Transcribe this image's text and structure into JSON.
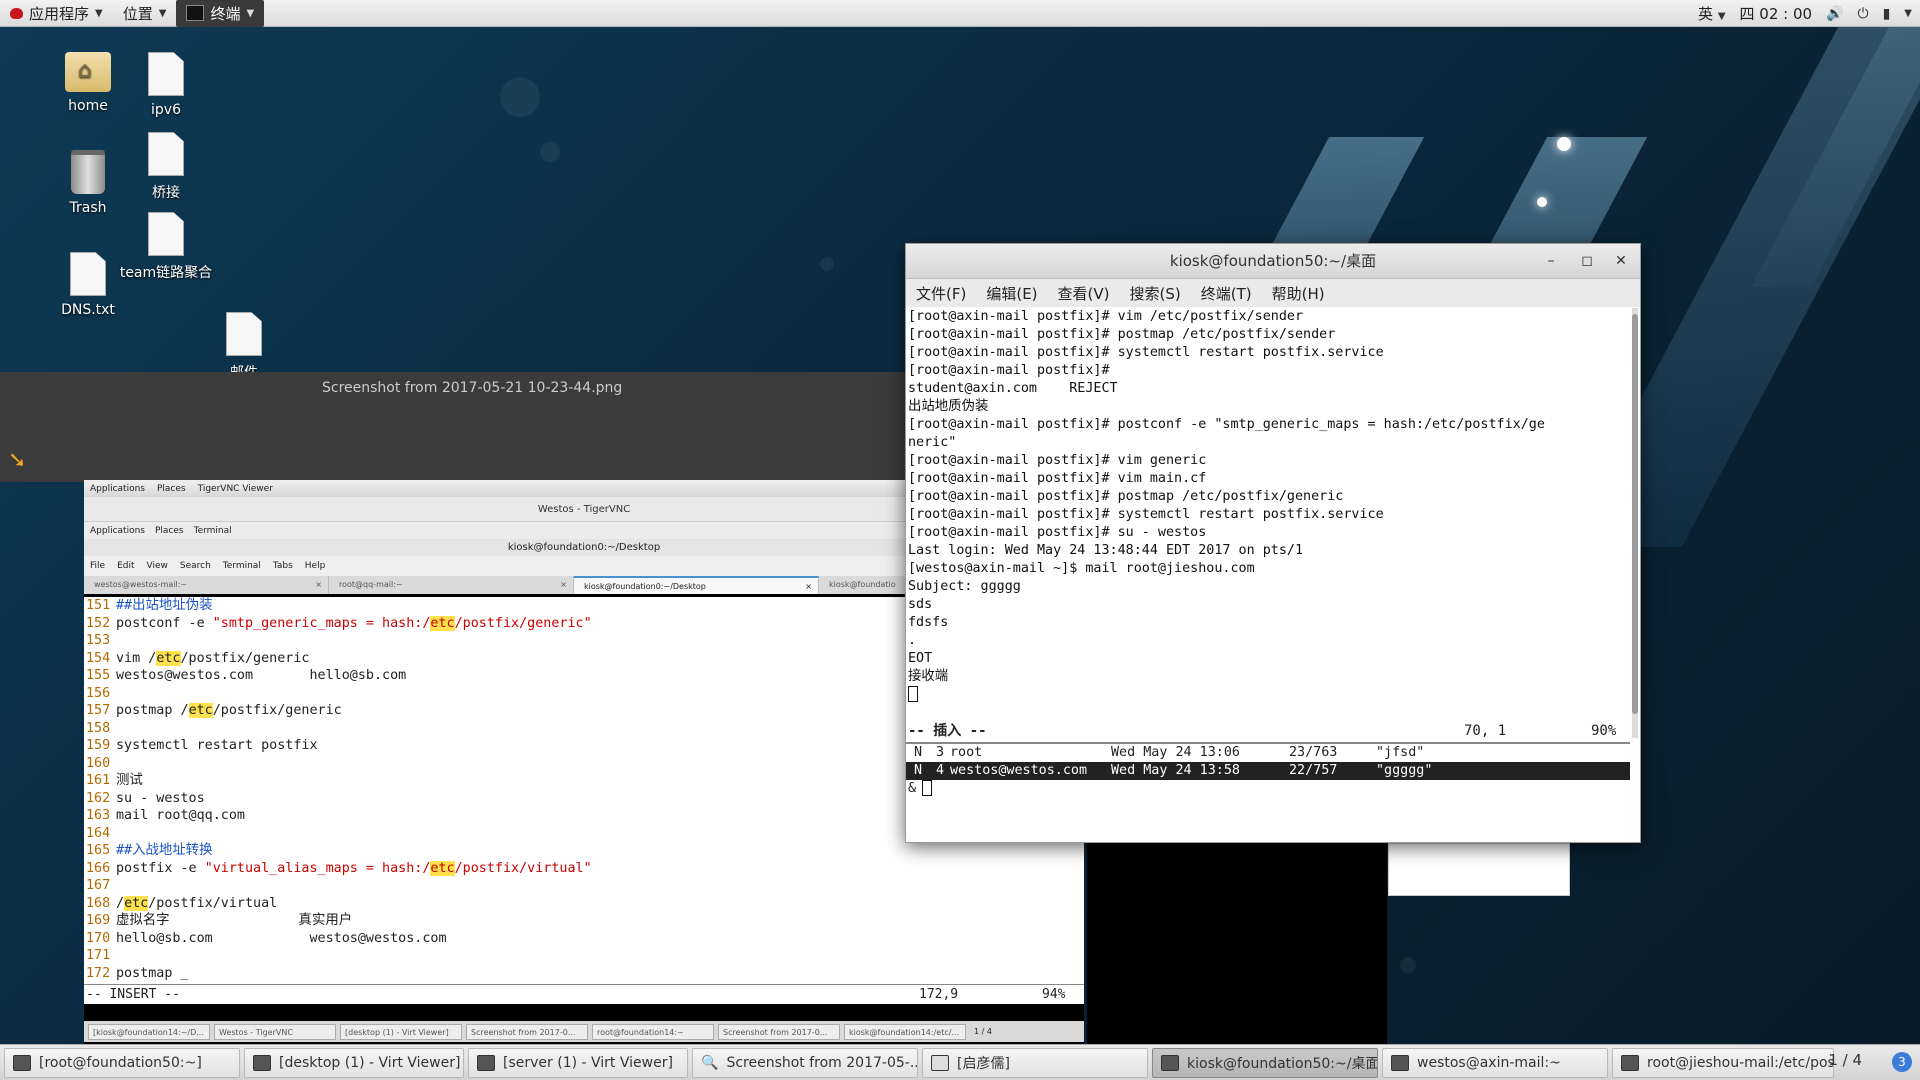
{
  "top_panel": {
    "applications": "应用程序",
    "places": "位置",
    "terminal": "终端",
    "input_method": "英",
    "clock": "四 02 : 00"
  },
  "desktop": {
    "icons": [
      "home",
      "ipv6",
      "Trash",
      "桥接",
      "team链路聚合",
      "DNS.txt",
      "邮件"
    ]
  },
  "viewer": {
    "title": "Screenshot from 2017-05-21 10-23-44.png"
  },
  "vnc": {
    "panel_apps": "Applications",
    "panel_places": "Places",
    "panel_viewer": "TigerVNC Viewer",
    "window_title": "Westos - TigerVNC",
    "inner_apps": "Applications",
    "inner_places": "Places",
    "inner_terminal": "Terminal",
    "term_title": "kiosk@foundation0:~/Desktop",
    "menu": [
      "File",
      "Edit",
      "View",
      "Search",
      "Terminal",
      "Tabs",
      "Help"
    ],
    "tabs": [
      "westos@westos-mail:~",
      "root@qq-mail:~",
      "kiosk@foundation0:~/Desktop",
      "kiosk@foundatio"
    ],
    "vim_lines": [
      {
        "n": "151",
        "parts": [
          {
            "t": "##出站地址伪装",
            "c": "cmt"
          }
        ]
      },
      {
        "n": "152",
        "parts": [
          {
            "t": "postconf -e ",
            "c": ""
          },
          {
            "t": "\"smtp_generic_maps = hash:/",
            "c": "str"
          },
          {
            "t": "etc",
            "c": "str hl"
          },
          {
            "t": "/postfix/generic\"",
            "c": "str"
          }
        ]
      },
      {
        "n": "153",
        "parts": []
      },
      {
        "n": "154",
        "parts": [
          {
            "t": "vim /",
            "c": ""
          },
          {
            "t": "etc",
            "c": "hl"
          },
          {
            "t": "/postfix/generic",
            "c": ""
          }
        ]
      },
      {
        "n": "155",
        "parts": [
          {
            "t": "westos@westos.com       hello@sb.com",
            "c": ""
          }
        ]
      },
      {
        "n": "156",
        "parts": []
      },
      {
        "n": "157",
        "parts": [
          {
            "t": "postmap /",
            "c": ""
          },
          {
            "t": "etc",
            "c": "hl"
          },
          {
            "t": "/postfix/generic",
            "c": ""
          }
        ]
      },
      {
        "n": "158",
        "parts": []
      },
      {
        "n": "159",
        "parts": [
          {
            "t": "systemctl restart postfix",
            "c": ""
          }
        ]
      },
      {
        "n": "160",
        "parts": []
      },
      {
        "n": "161",
        "parts": [
          {
            "t": "测试",
            "c": ""
          }
        ]
      },
      {
        "n": "162",
        "parts": [
          {
            "t": "su - westos",
            "c": ""
          }
        ]
      },
      {
        "n": "163",
        "parts": [
          {
            "t": "mail root@qq.com",
            "c": ""
          }
        ]
      },
      {
        "n": "164",
        "parts": []
      },
      {
        "n": "165",
        "parts": [
          {
            "t": "##入战地址转换",
            "c": "cmt"
          }
        ]
      },
      {
        "n": "166",
        "parts": [
          {
            "t": "postfix -e ",
            "c": ""
          },
          {
            "t": "\"virtual_alias_maps = hash:/",
            "c": "str"
          },
          {
            "t": "etc",
            "c": "str hl"
          },
          {
            "t": "/postfix/virtual\"",
            "c": "str"
          }
        ]
      },
      {
        "n": "167",
        "parts": []
      },
      {
        "n": "168",
        "parts": [
          {
            "t": "/",
            "c": ""
          },
          {
            "t": "etc",
            "c": "hl"
          },
          {
            "t": "/postfix/virtual",
            "c": ""
          }
        ]
      },
      {
        "n": "169",
        "parts": [
          {
            "t": "虚拟名字                真实用户",
            "c": ""
          }
        ]
      },
      {
        "n": "170",
        "parts": [
          {
            "t": "hello@sb.com            westos@westos.com",
            "c": ""
          }
        ]
      },
      {
        "n": "171",
        "parts": []
      },
      {
        "n": "172",
        "parts": [
          {
            "t": "postmap _",
            "c": ""
          }
        ]
      }
    ],
    "vim_mode": "-- INSERT --",
    "vim_pos": "172,9",
    "vim_pct": "94%",
    "taskbar": [
      "[kiosk@foundation14:~/D...",
      "Westos - TigerVNC",
      "[desktop (1) - Virt Viewer]",
      "Screenshot from 2017-0...",
      "root@foundation14:~",
      "Screenshot from 2017-0...",
      "kiosk@foundation14:/etc/...",
      "1 / 4"
    ]
  },
  "terminal": {
    "title": "kiosk@foundation50:~/桌面",
    "menu": [
      "文件(F)",
      "编辑(E)",
      "查看(V)",
      "搜索(S)",
      "终端(T)",
      "帮助(H)"
    ],
    "lines": [
      "[root@axin-mail postfix]# vim /etc/postfix/sender",
      "[root@axin-mail postfix]# postmap /etc/postfix/sender",
      "[root@axin-mail postfix]# systemctl restart postfix.service",
      "[root@axin-mail postfix]#",
      "student@axin.com    REJECT",
      "出站地质伪装",
      "[root@axin-mail postfix]# postconf -e \"smtp_generic_maps = hash:/etc/postfix/ge",
      "neric\"",
      "[root@axin-mail postfix]# vim generic",
      "[root@axin-mail postfix]# vim main.cf",
      "[root@axin-mail postfix]# postmap /etc/postfix/generic",
      "[root@axin-mail postfix]# systemctl restart postfix.service",
      "[root@axin-mail postfix]# su - westos",
      "Last login: Wed May 24 13:48:44 EDT 2017 on pts/1",
      "[westos@axin-mail ~]$ mail root@jieshou.com",
      "Subject: ggggg",
      "sds",
      "fdsfs",
      ".",
      "EOT",
      "接收端"
    ],
    "mode": "-- 插入 --",
    "pos": "70, 1",
    "pct": "90%",
    "mail_rows": [
      {
        "flag": "N",
        "num": "3",
        "from": "root",
        "date": "Wed May 24 13:06",
        "size": "23/763",
        "subject": "\"jfsd\""
      },
      {
        "flag": "N",
        "num": "4",
        "from": "westos@westos.com",
        "date": "Wed May 24 13:58",
        "size": "22/757",
        "subject": "\"ggggg\""
      }
    ],
    "prompt": "&"
  },
  "taskbar": {
    "items": [
      "[root@foundation50:~]",
      "[desktop (1) - Virt Viewer]",
      "[server (1) - Virt Viewer]",
      "Screenshot from 2017-05-...",
      "[启彦儒]",
      "kiosk@foundation50:~/桌面",
      "westos@axin-mail:~",
      "root@jieshou-mail:/etc/pos..."
    ],
    "workspace": "1 / 4",
    "badge": "3"
  },
  "colors": {
    "comment_blue": "#1a53c9",
    "string_red": "#c00000",
    "search_highlight": "#ffe14d",
    "line_number": "#b26a00"
  }
}
